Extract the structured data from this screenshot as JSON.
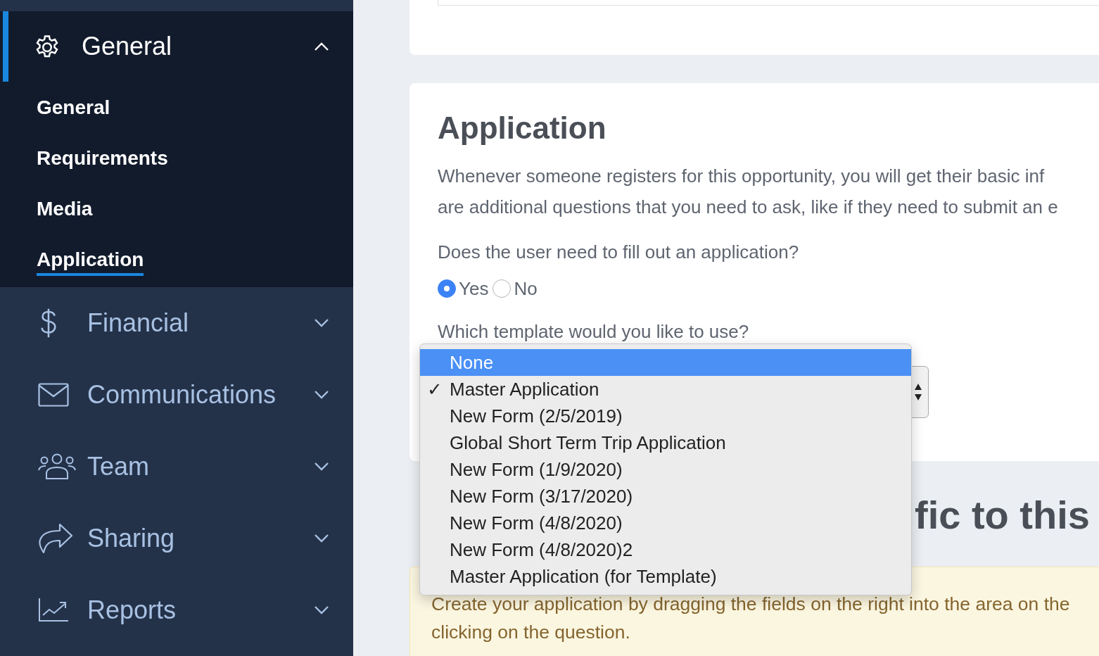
{
  "sidebar": {
    "groups": [
      {
        "label": "General",
        "expanded": true,
        "active": true,
        "children": [
          {
            "label": "General",
            "selected": false
          },
          {
            "label": "Requirements",
            "selected": false
          },
          {
            "label": "Media",
            "selected": false
          },
          {
            "label": "Application",
            "selected": true
          }
        ]
      },
      {
        "label": "Financial",
        "expanded": false,
        "active": false
      },
      {
        "label": "Communications",
        "expanded": false,
        "active": false
      },
      {
        "label": "Team",
        "expanded": false,
        "active": false
      },
      {
        "label": "Sharing",
        "expanded": false,
        "active": false
      },
      {
        "label": "Reports",
        "expanded": false,
        "active": false
      }
    ]
  },
  "application_card": {
    "title": "Application",
    "description_lines": [
      "Whenever someone registers for this opportunity, you will get their basic inf",
      "are additional questions that you need to ask, like if they need to submit an e"
    ],
    "question": "Does the user need to fill out an application?",
    "answers": [
      {
        "label": "Yes",
        "selected": true
      },
      {
        "label": "No",
        "selected": false
      }
    ],
    "template_label": "Which template would you like to use?"
  },
  "section_heading_parts": [
    "fic to this"
  ],
  "notice_lines": [
    "Create your application by dragging the fields on the right into the area on the",
    "clicking on the question."
  ],
  "template_dropdown": {
    "check_glyph": "✓",
    "options": [
      {
        "label": "None",
        "highlighted": true,
        "checked": false
      },
      {
        "label": "Master Application",
        "highlighted": false,
        "checked": true
      },
      {
        "label": "New Form (2/5/2019)",
        "highlighted": false,
        "checked": false
      },
      {
        "label": "Global Short Term Trip Application",
        "highlighted": false,
        "checked": false
      },
      {
        "label": "New Form (1/9/2020)",
        "highlighted": false,
        "checked": false
      },
      {
        "label": "New Form (3/17/2020)",
        "highlighted": false,
        "checked": false
      },
      {
        "label": "New Form (4/8/2020)",
        "highlighted": false,
        "checked": false
      },
      {
        "label": "New Form (4/8/2020)2",
        "highlighted": false,
        "checked": false
      },
      {
        "label": "Master Application (for Template)",
        "highlighted": false,
        "checked": false
      }
    ]
  }
}
